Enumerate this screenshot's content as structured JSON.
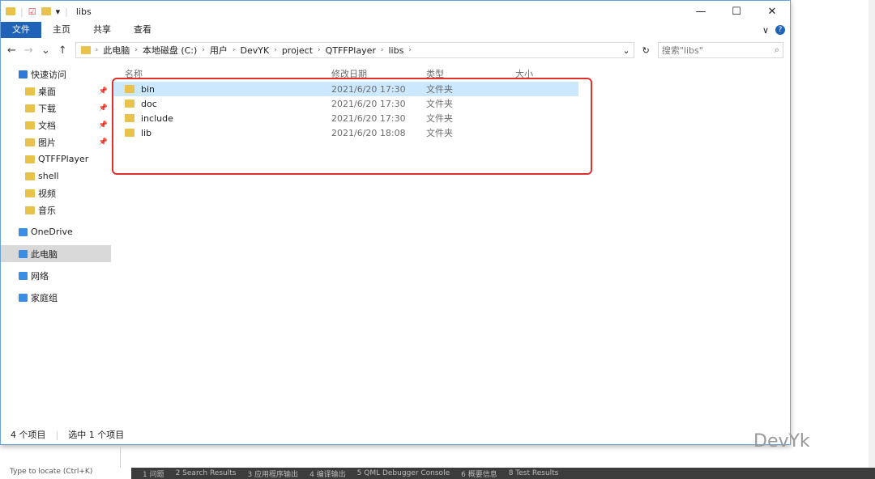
{
  "window": {
    "title": "libs",
    "minimize": "—",
    "maximize": "☐",
    "close": "✕"
  },
  "ribbon": {
    "tabs": [
      "文件",
      "主页",
      "共享",
      "查看"
    ],
    "expand": "∨",
    "help": "?"
  },
  "nav": {
    "back": "←",
    "forward": "→",
    "recent": "⌄",
    "up": "↑",
    "breadcrumbs": [
      "此电脑",
      "本地磁盘 (C:)",
      "用户",
      "DevYK",
      "project",
      "QTFFPlayer",
      "libs"
    ],
    "refresh": "↻",
    "search_placeholder": "搜索\"libs\""
  },
  "sidebar": {
    "items": [
      {
        "label": "快速访问",
        "top": true
      },
      {
        "label": "桌面",
        "pin": true
      },
      {
        "label": "下载",
        "pin": true
      },
      {
        "label": "文档",
        "pin": true
      },
      {
        "label": "图片",
        "pin": true
      },
      {
        "label": "QTFFPlayer"
      },
      {
        "label": "shell"
      },
      {
        "label": "视频"
      },
      {
        "label": "音乐"
      },
      {
        "label": "OneDrive",
        "top": true
      },
      {
        "label": "此电脑",
        "top": true,
        "selected": true
      },
      {
        "label": "网络",
        "top": true
      },
      {
        "label": "家庭组",
        "top": true
      }
    ]
  },
  "columns": [
    "名称",
    "修改日期",
    "类型",
    "大小"
  ],
  "files": [
    {
      "name": "bin",
      "date": "2021/6/20 17:30",
      "type": "文件夹",
      "selected": true
    },
    {
      "name": "doc",
      "date": "2021/6/20 17:30",
      "type": "文件夹"
    },
    {
      "name": "include",
      "date": "2021/6/20 17:30",
      "type": "文件夹"
    },
    {
      "name": "lib",
      "date": "2021/6/20 18:08",
      "type": "文件夹"
    }
  ],
  "status": {
    "count": "4 个项目",
    "selected": "选中 1 个项目"
  },
  "watermark": "DevYk",
  "bottom": {
    "locate": "Type to locate (Ctrl+K)",
    "tabs": [
      "1 问题",
      "2 Search Results",
      "3 应用程序输出",
      "4 编译输出",
      "5 QML Debugger Console",
      "6 概要信息",
      "8 Test Results"
    ]
  }
}
